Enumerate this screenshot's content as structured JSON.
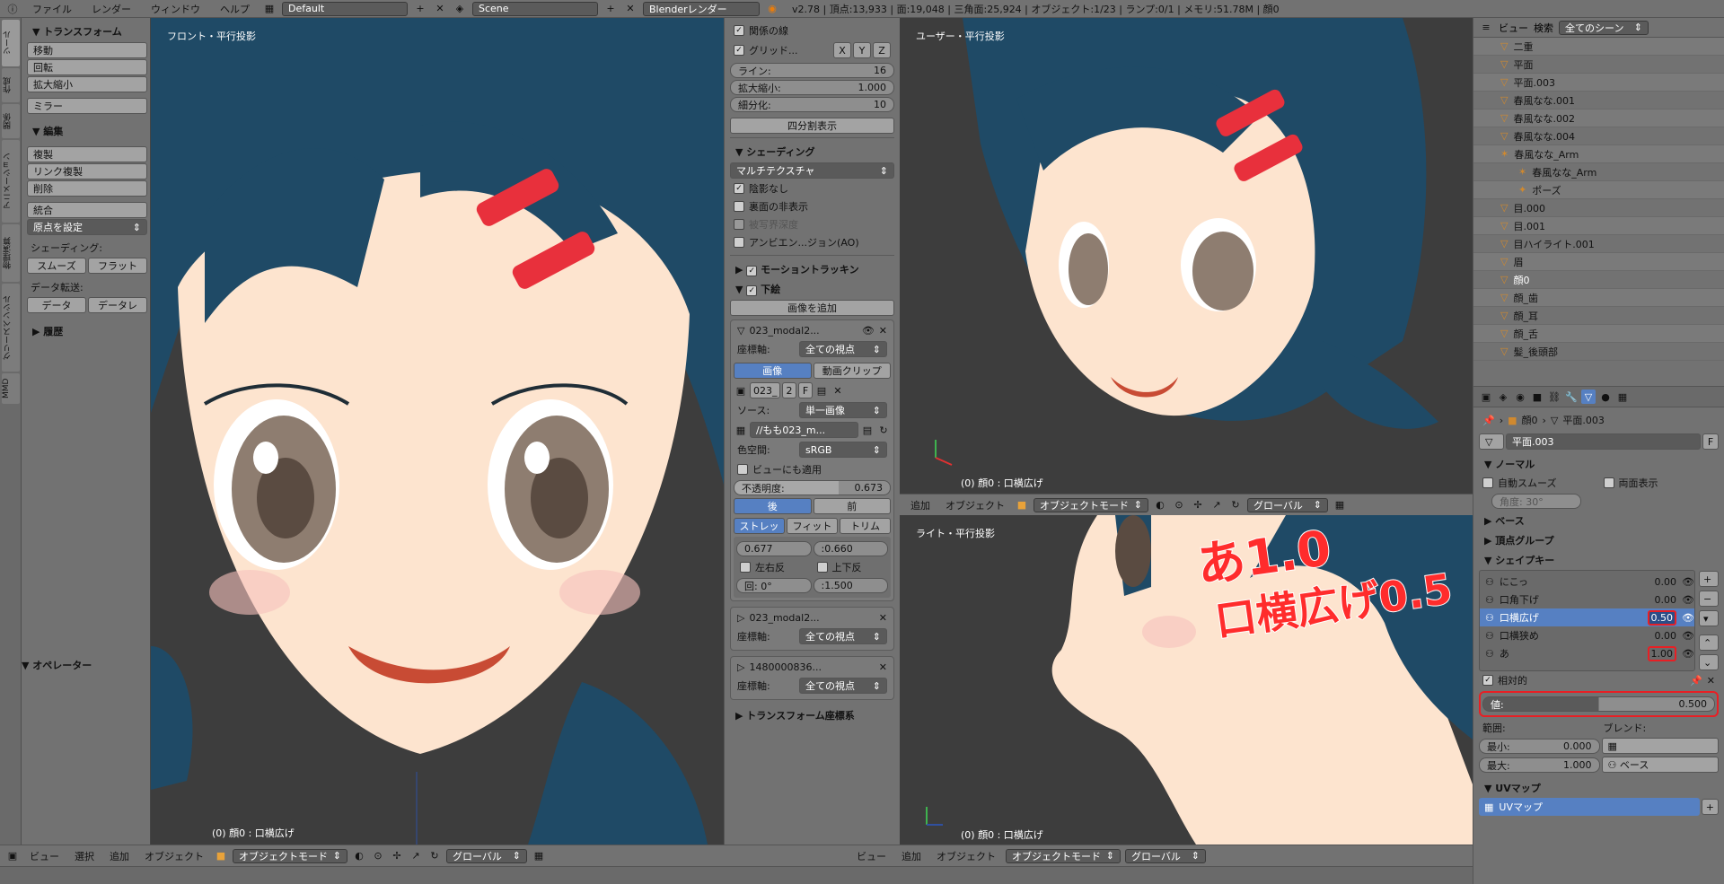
{
  "topbar": {
    "menus": [
      "ファイル",
      "レンダー",
      "ウィンドウ",
      "ヘルプ"
    ],
    "layout": "Default",
    "scene": "Scene",
    "engine": "Blenderレンダー",
    "stats": "v2.78 | 頂点:13,933 | 面:19,048 | 三角面:25,924 | オブジェクト:1/23 | ランプ:0/1 | メモリ:51.78M | 顔0"
  },
  "vtabs": [
    "ツール",
    "作成",
    "関係",
    "アニメーション",
    "物理演算",
    "グリースペンシル",
    "MMD"
  ],
  "toolshelf": {
    "transform_header": "トランスフォーム",
    "transform_buttons": [
      "移動",
      "回転",
      "拡大縮小"
    ],
    "mirror": "ミラー",
    "edit_header": "編集",
    "edit_buttons": [
      "複製",
      "リンク複製",
      "削除"
    ],
    "join": "統合",
    "origin": "原点を設定",
    "shading_label": "シェーディング:",
    "smooth": "スムーズ",
    "flat": "フラット",
    "data_transfer_label": "データ転送:",
    "data": "データ",
    "data_layer": "データレ",
    "history": "履歴",
    "operator": "オペレーター"
  },
  "front_view": {
    "label": "フロント・平行投影",
    "status": "(0) 顔0 : 口横広げ"
  },
  "user_view": {
    "label": "ユーザー・平行投影",
    "status": "(0) 顔0 : 口横広げ"
  },
  "right_view": {
    "label": "ライト・平行投影",
    "status": "(0) 顔0 : 口横広げ"
  },
  "mid_header": {
    "menus": [
      "追加",
      "オブジェクト"
    ],
    "mode": "オブジェクトモード",
    "orientation": "グローバル"
  },
  "props_panel": {
    "relation_lines": "関係の線",
    "grid_floor": "グリッド...",
    "axes": [
      "X",
      "Y",
      "Z"
    ],
    "lines_label": "ライン:",
    "lines_value": "16",
    "scale_label": "拡大縮小:",
    "scale_value": "1.000",
    "subdiv_label": "細分化:",
    "subdiv_value": "10",
    "quadview": "四分割表示",
    "shading_header": "シェーディング",
    "shading_mode": "マルチテクスチャ",
    "shadeless": "陰影なし",
    "backface": "裏面の非表示",
    "dof": "被写界深度",
    "ao": "アンビエン...ジョン(AO)",
    "motion_tracking": "モーショントラッキン",
    "bg_header": "下絵",
    "add_image": "画像を追加",
    "bg1_name": "023_modal2...",
    "axis_label": "座標軸:",
    "axis_value": "全ての視点",
    "image_tab": "画像",
    "clip_tab": "動画クリップ",
    "img_name": "023_",
    "img_users": "2",
    "img_f": "F",
    "source_label": "ソース:",
    "source_value": "単一画像",
    "filepath": "//もも023_m...",
    "colorspace_label": "色空間:",
    "colorspace_value": "sRGB",
    "view_apply": "ビューにも適用",
    "opacity_label": "不透明度:",
    "opacity_value": "0.673",
    "back": "後",
    "front": "前",
    "stretch": "ストレッ",
    "fit": "フィット",
    "crop": "トリム",
    "x_value": "0.677",
    "y_value": ":0.660",
    "flip_x": "左右反",
    "flip_y": "上下反",
    "rot_value": "回: 0°",
    "size_value": ":1.500",
    "bg2_name": "023_modal2...",
    "bg2_axis": "全ての視点",
    "bg3_name": "1480000836...",
    "bg3_axis": "全ての視点",
    "transform_orient": "トランスフォーム座標系"
  },
  "outliner": {
    "header_view": "ビュー",
    "header_search": "検索",
    "header_scene": "全てのシーン",
    "items": [
      "二重",
      "平面",
      "平面.003",
      "春風なな.001",
      "春風なな.002",
      "春風なな.004",
      "春風なな_Arm",
      "春風なな_Arm",
      "ポーズ",
      "目.000",
      "目.001",
      "目ハイライト.001",
      "眉",
      "顔0",
      "顔_歯",
      "顔_耳",
      "顔_舌",
      "髪_後頭部"
    ]
  },
  "properties": {
    "breadcrumb_obj": "顔0",
    "breadcrumb_mesh": "平面.003",
    "mesh_name": "平面.003",
    "mesh_f": "F",
    "normal_header": "ノーマル",
    "auto_smooth": "自動スムーズ",
    "double_sided": "両面表示",
    "angle": "角度: 30°",
    "uv_space": "ベース",
    "vgroups": "頂点グループ",
    "shape_keys_header": "シェイプキー",
    "shape_keys": [
      {
        "name": "にこっ",
        "value": "0.00"
      },
      {
        "name": "口角下げ",
        "value": "0.00"
      },
      {
        "name": "口横広げ",
        "value": "0.50"
      },
      {
        "name": "口横狭め",
        "value": "0.00"
      },
      {
        "name": "あ",
        "value": "1.00"
      }
    ],
    "relative": "相対的",
    "value_label": "値:",
    "value": "0.500",
    "range_label": "範囲:",
    "blend_label": "ブレンド:",
    "min_label": "最小:",
    "min_value": "0.000",
    "max_label": "最大:",
    "max_value": "1.000",
    "blend_value": "ベース",
    "uv_header": "UVマップ",
    "uv_map": "UVマップ"
  },
  "annotation": {
    "line1": "あ1.0",
    "line2": "口横広げ0.5"
  },
  "footer": {
    "menus": [
      "ビュー",
      "選択",
      "追加",
      "オブジェクト"
    ],
    "mode": "オブジェクトモード",
    "orientation": "グローバル"
  },
  "colors": {
    "skin": "#fde4cf",
    "hair": "#1f4a66",
    "clip": "#e8303c",
    "mouth": "#c84b34",
    "selected": "#5680c2",
    "annotation": "#ff2c2c"
  }
}
